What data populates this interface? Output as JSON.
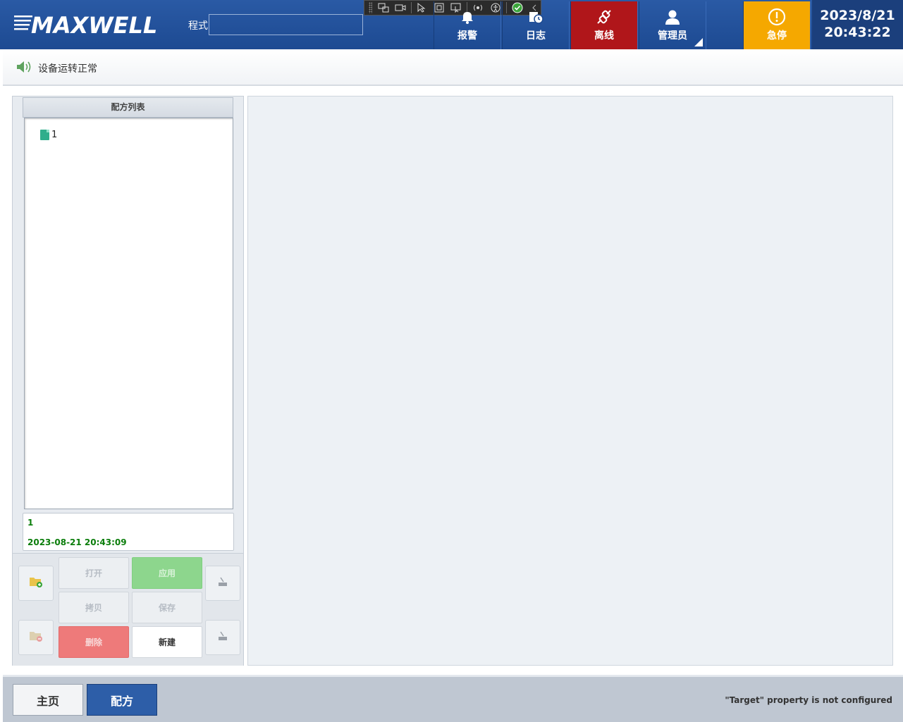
{
  "header": {
    "logo_text": "MAXWELL",
    "program_label": "程式",
    "program_value": "",
    "buttons": {
      "alarm": "报警",
      "log": "日志",
      "offline": "离线",
      "user": "管理员",
      "estop": "急停"
    },
    "date": "2023/8/21",
    "time": "20:43:22"
  },
  "status": {
    "text": "设备运转正常"
  },
  "recipe_list": {
    "title": "配方列表",
    "items": [
      "1"
    ],
    "selected": {
      "name": "1",
      "date": "2023-08-21 20:43:09"
    }
  },
  "actions": {
    "open": "打开",
    "apply": "应用",
    "copy": "拷贝",
    "save": "保存",
    "delete": "删除",
    "new": "新建"
  },
  "footer": {
    "home": "主页",
    "recipe": "配方",
    "message": "\"Target\" property is not configured"
  },
  "colors": {
    "header_blue": "#1d4a92",
    "offline_red": "#b0161a",
    "estop_amber": "#f5a800",
    "apply_green": "#8dd68d",
    "delete_red": "#ee7a7a",
    "info_green": "#0a7d0a"
  }
}
